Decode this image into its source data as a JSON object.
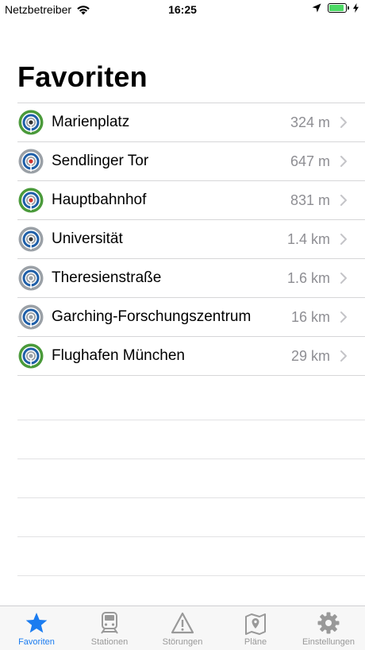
{
  "status_bar": {
    "carrier": "Netzbetreiber",
    "time": "16:25",
    "battery_percent": 90
  },
  "page": {
    "title": "Favoriten"
  },
  "favorites": [
    {
      "name": "Marienplatz",
      "distance": "324 m",
      "ring_color": "#4a9a3a",
      "dot_color": "#333333"
    },
    {
      "name": "Sendlinger Tor",
      "distance": "647 m",
      "ring_color": "#9aa0a6",
      "dot_color": "#d0312d"
    },
    {
      "name": "Hauptbahnhof",
      "distance": "831 m",
      "ring_color": "#4a9a3a",
      "dot_color": "#d0312d"
    },
    {
      "name": "Universität",
      "distance": "1.4 km",
      "ring_color": "#9aa0a6",
      "dot_color": "#333333"
    },
    {
      "name": "Theresienstraße",
      "distance": "1.6 km",
      "ring_color": "#9aa0a6",
      "dot_color": "#9aa0a6"
    },
    {
      "name": "Garching-Forschungszentrum",
      "distance": "16 km",
      "ring_color": "#9aa0a6",
      "dot_color": "#9aa0a6"
    },
    {
      "name": "Flughafen München",
      "distance": "29 km",
      "ring_color": "#4a9a3a",
      "dot_color": "#9aa0a6"
    }
  ],
  "tabs": [
    {
      "label": "Favoriten",
      "icon": "star-icon",
      "active": true
    },
    {
      "label": "Stationen",
      "icon": "train-icon",
      "active": false
    },
    {
      "label": "Störungen",
      "icon": "warning-icon",
      "active": false
    },
    {
      "label": "Pläne",
      "icon": "map-icon",
      "active": false
    },
    {
      "label": "Einstellungen",
      "icon": "gear-icon",
      "active": false
    }
  ],
  "colors": {
    "accent": "#1b7cf0",
    "inactive_tab": "#999999",
    "separator": "#d6d6d8",
    "secondary_text": "#8e8e93",
    "station_blue": "#1f5fa8"
  }
}
